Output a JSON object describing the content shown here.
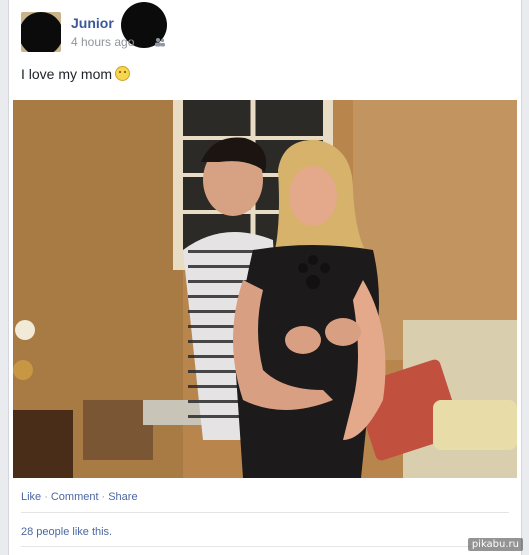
{
  "post": {
    "author_name": "Junior",
    "timestamp": "4 hours ago",
    "status_text": "I love my mom",
    "emoji": "smiley-emoji"
  },
  "actions": {
    "like": "Like",
    "comment": "Comment",
    "share": "Share",
    "separator": "·"
  },
  "likes_text": "28 people like this.",
  "watermark": "pikabu.ru",
  "icons": {
    "audience": "friends-icon"
  },
  "colors": {
    "link": "#4b67a1",
    "author": "#3b5998",
    "meta": "#90949c",
    "background": "#e9ebee"
  }
}
